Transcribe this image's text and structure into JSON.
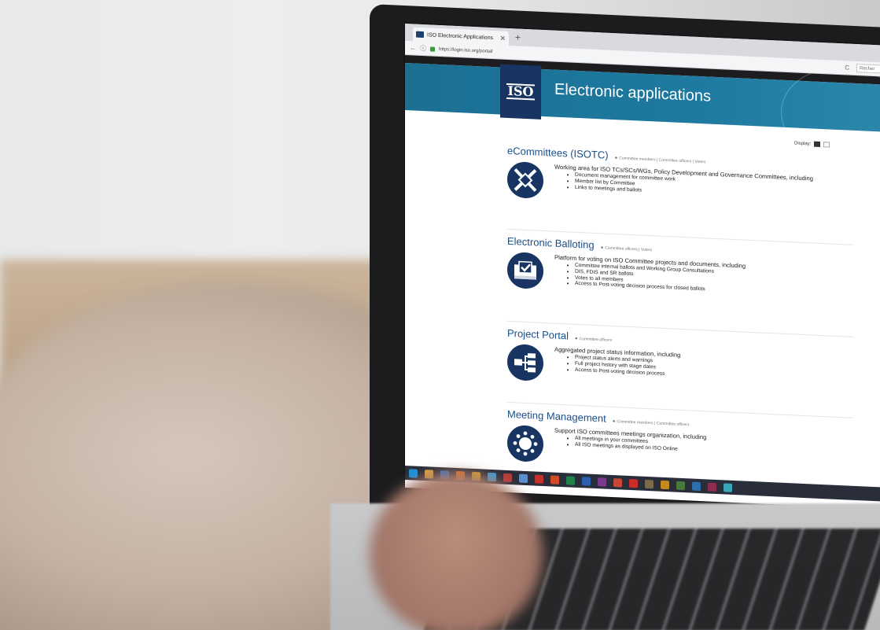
{
  "browser": {
    "tab_title": "ISO Electronic Applications",
    "tab_close": "✕",
    "new_tab": "+",
    "url": "https://login.iso.org/portal/",
    "search_placeholder": "Recher"
  },
  "banner": {
    "logo": "ISO",
    "title": "Electronic applications"
  },
  "display": {
    "label": "Display:"
  },
  "sections": [
    {
      "title": "eCommittees (ISOTC)",
      "roles": "Committee members | Committee officers | Voters",
      "description": "Working area for ISO TCs/SCs/WGs, Policy Development and Governance Committees, including",
      "items": [
        "Document management for committee work",
        "Member list by Committee",
        "Links to meetings and ballots"
      ],
      "icon": "compass-arrows-icon"
    },
    {
      "title": "Electronic Balloting",
      "roles": "Committee officers | Voters",
      "description": "Platform for voting on ISO Committee projects and documents, including",
      "items": [
        "Committee internal ballots and Working Group Consultations",
        "DIS, FDIS and SR ballots",
        "Votes to all members",
        "Access to Post-voting decision process for closed ballots"
      ],
      "icon": "ballot-box-icon"
    },
    {
      "title": "Project Portal",
      "roles": "Committee officers",
      "description": "Aggregated project status information, including",
      "items": [
        "Project status alerts and warnings",
        "Full project history with stage dates",
        "Access to Post-voting decision process"
      ],
      "icon": "hierarchy-icon"
    },
    {
      "title": "Meeting Management",
      "roles": "Committee members | Committee officers",
      "description": "Support ISO committees meetings organization, including",
      "items": [
        "All meetings in your committees",
        "All ISO meetings as displayed on ISO Online"
      ],
      "icon": "meeting-table-icon"
    }
  ],
  "taskbar": {
    "icons": [
      "windows-start-icon",
      "file-explorer-icon",
      "outlook-icon",
      "firefox-icon",
      "chrome-icon",
      "ie-icon",
      "paint-icon",
      "notepad-icon",
      "filezilla-icon",
      "powerpoint-icon",
      "excel-icon",
      "word-icon",
      "onenote-icon",
      "tool-icon",
      "acrobat-icon",
      "app-icon",
      "app-icon-2",
      "app-icon-3",
      "app-icon-4",
      "app-icon-5",
      "app-icon-6"
    ],
    "colors": [
      "#1e8fd6",
      "#d9a441",
      "#2b6cc4",
      "#e8691d",
      "#dba125",
      "#3d9ad1",
      "#b23b3b",
      "#5d8fc9",
      "#c4302b",
      "#d04b26",
      "#21834a",
      "#2b5fb0",
      "#7a3b8f",
      "#c74634",
      "#cc2b2b",
      "#7a6b4a",
      "#c48a1f",
      "#4a7a3a",
      "#2d6fae",
      "#8f2b4f",
      "#3aa7b8"
    ]
  }
}
